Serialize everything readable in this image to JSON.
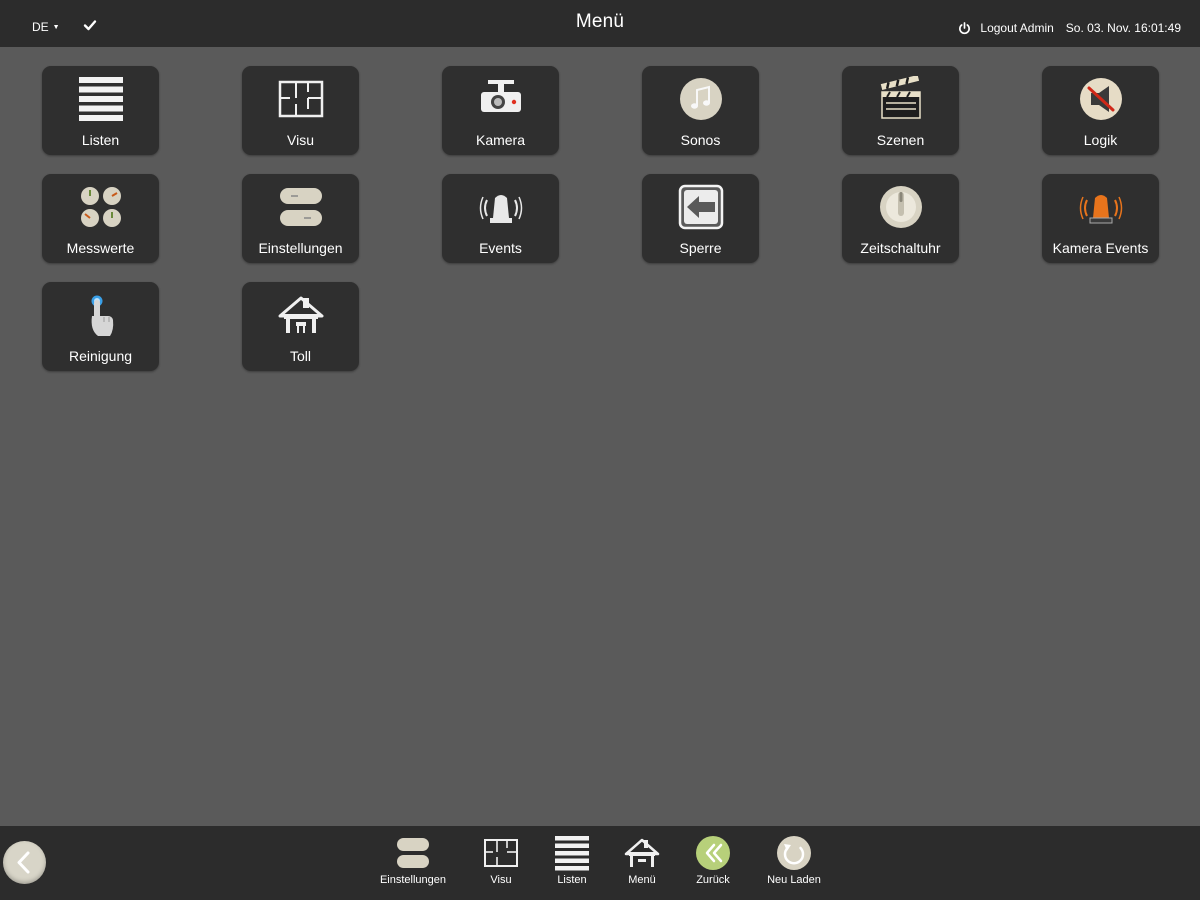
{
  "topbar": {
    "language": "DE",
    "title": "Menü",
    "logout_label": "Logout Admin",
    "datetime": "So. 03. Nov. 16:01:49"
  },
  "tiles": [
    {
      "label": "Listen",
      "icon": "list-icon"
    },
    {
      "label": "Visu",
      "icon": "floorplan-icon"
    },
    {
      "label": "Kamera",
      "icon": "camera-icon"
    },
    {
      "label": "Sonos",
      "icon": "music-note-icon"
    },
    {
      "label": "Szenen",
      "icon": "clapperboard-icon"
    },
    {
      "label": "Logik",
      "icon": "logic-icon"
    },
    {
      "label": "Messwerte",
      "icon": "gauges-icon"
    },
    {
      "label": "Einstellungen",
      "icon": "toggle-switches-icon"
    },
    {
      "label": "Events",
      "icon": "alarm-light-icon"
    },
    {
      "label": "Sperre",
      "icon": "lock-arrow-icon"
    },
    {
      "label": "Zeitschaltuhr",
      "icon": "timer-knob-icon"
    },
    {
      "label": "Kamera Events",
      "icon": "orange-alarm-light-icon"
    },
    {
      "label": "Reinigung",
      "icon": "touch-hand-icon"
    },
    {
      "label": "Toll",
      "icon": "house-icon"
    }
  ],
  "bottombar": {
    "items": [
      {
        "label": "Einstellungen",
        "icon": "toggle-switches-icon"
      },
      {
        "label": "Visu",
        "icon": "floorplan-icon"
      },
      {
        "label": "Listen",
        "icon": "list-icon"
      },
      {
        "label": "Menü",
        "icon": "house-icon"
      },
      {
        "label": "Zurück",
        "icon": "double-chevron-left-icon"
      },
      {
        "label": "Neu Laden",
        "icon": "reload-icon"
      }
    ]
  },
  "colors": {
    "topbar_bg": "#2c2c2c",
    "page_bg": "#5a5a5a",
    "tile_bg": "#2f2f2f",
    "orange_accent": "#e8741c",
    "green_accent": "#b7d07a"
  }
}
